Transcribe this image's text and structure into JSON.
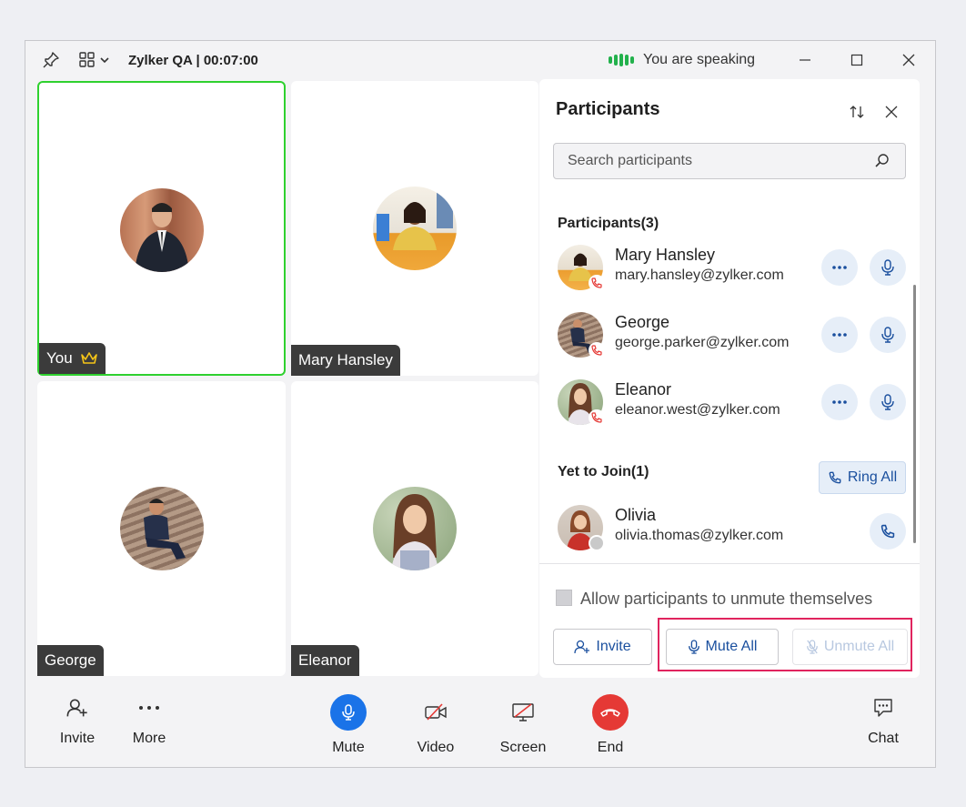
{
  "title_bar": {
    "meeting_title": "Zylker QA | 00:07:00",
    "speaking_status": "You are speaking"
  },
  "tiles": [
    {
      "label": "You",
      "is_host": true,
      "active": true
    },
    {
      "label": "Mary Hansley"
    },
    {
      "label": "George"
    },
    {
      "label": "Eleanor"
    }
  ],
  "panel": {
    "title": "Participants",
    "search_placeholder": "Search participants",
    "participants_heading": "Participants(3)",
    "participants": [
      {
        "name": "Mary Hansley",
        "email": "mary.hansley@zylker.com"
      },
      {
        "name": "George",
        "email": "george.parker@zylker.com"
      },
      {
        "name": "Eleanor",
        "email": "eleanor.west@zylker.com"
      }
    ],
    "yet_to_join_heading": "Yet to Join(1)",
    "ring_all_label": "Ring All",
    "yet_to_join": [
      {
        "name": "Olivia",
        "email": "olivia.thomas@zylker.com"
      }
    ],
    "allow_unmute_label": "Allow participants to unmute themselves",
    "invite_label": "Invite",
    "mute_all_label": "Mute All",
    "unmute_all_label": "Unmute All"
  },
  "toolbar": {
    "invite": "Invite",
    "more": "More",
    "mute": "Mute",
    "video": "Video",
    "screen": "Screen",
    "end": "End",
    "chat": "Chat"
  },
  "colors": {
    "speaking_green": "#22b14c",
    "active_tile_border": "#2fd12f",
    "mute_blue": "#1a73e8",
    "end_red": "#e53935",
    "highlight": "#e0245e",
    "accent_blue": "#1a4f9e"
  }
}
